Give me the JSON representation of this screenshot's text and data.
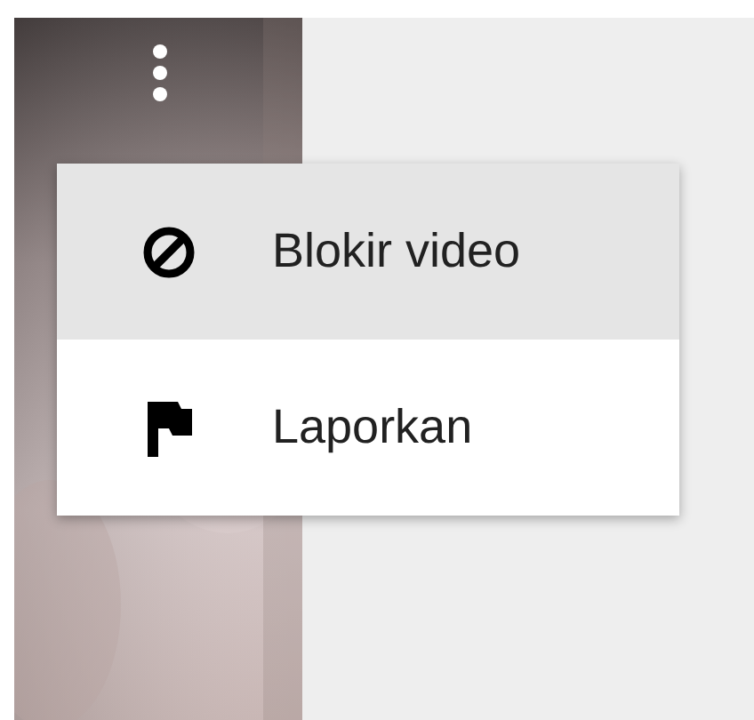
{
  "menu": {
    "items": [
      {
        "kind": "block",
        "label": "Blokir video",
        "selected": true
      },
      {
        "kind": "flag",
        "label": "Laporkan",
        "selected": false
      }
    ]
  }
}
